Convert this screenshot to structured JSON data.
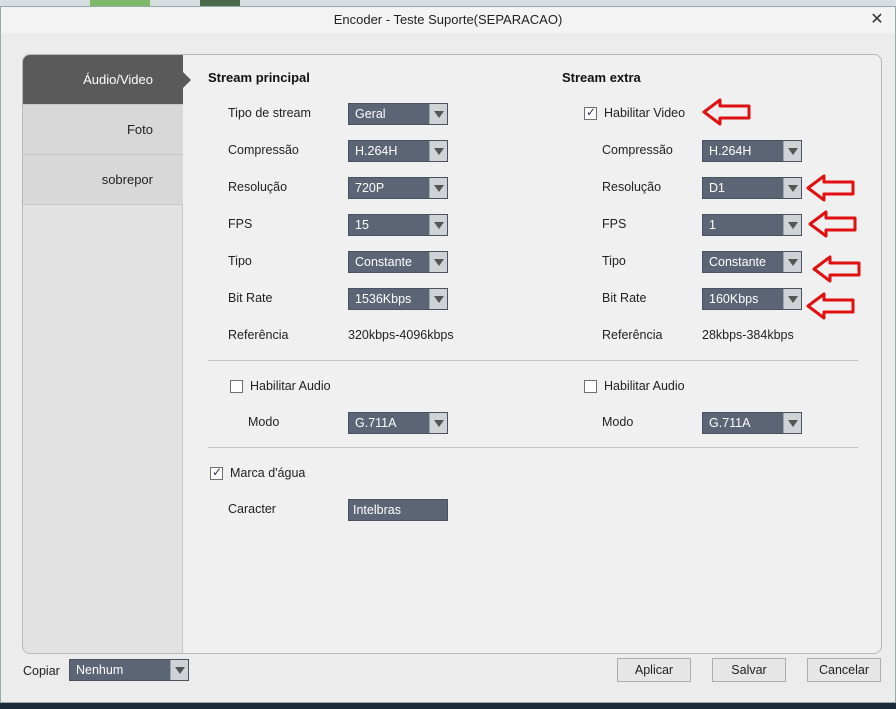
{
  "window": {
    "title": "Encoder  - Teste Suporte(SEPARACAO)",
    "close": "✕"
  },
  "sidebar": {
    "items": [
      {
        "label": "Áudio/Video",
        "active": true
      },
      {
        "label": "Foto",
        "active": false
      },
      {
        "label": "sobrepor",
        "active": false
      }
    ]
  },
  "main": {
    "title": "Stream principal",
    "rows": [
      {
        "label": "Tipo de stream",
        "value": "Geral"
      },
      {
        "label": "Compressão",
        "value": "H.264H"
      },
      {
        "label": "Resolução",
        "value": "720P"
      },
      {
        "label": "FPS",
        "value": "15"
      },
      {
        "label": "Tipo",
        "value": "Constante"
      },
      {
        "label": "Bit  Rate",
        "value": "1536Kbps"
      },
      {
        "label": "Referência",
        "value": "320kbps-4096kbps"
      }
    ],
    "audio": {
      "label": "Habilitar Audio",
      "checked": false,
      "mode_label": "Modo",
      "mode_value": "G.711A"
    }
  },
  "extra": {
    "title": "Stream extra",
    "enable_video": {
      "label": "Habilitar Video",
      "checked": true
    },
    "rows": [
      {
        "label": "Compressão",
        "value": "H.264H"
      },
      {
        "label": "Resolução",
        "value": "D1"
      },
      {
        "label": "FPS",
        "value": "1"
      },
      {
        "label": "Tipo",
        "value": "Constante"
      },
      {
        "label": "Bit  Rate",
        "value": "160Kbps"
      },
      {
        "label": "Referência",
        "value": "28kbps-384kbps"
      }
    ],
    "audio": {
      "label": "Habilitar Audio",
      "checked": false,
      "mode_label": "Modo",
      "mode_value": "G.711A"
    }
  },
  "watermark": {
    "label": "Marca d'água",
    "checked": true,
    "char_label": "Caracter",
    "char_value": "Intelbras"
  },
  "footer": {
    "copy_label": "Copiar",
    "copy_value": "Nenhum",
    "apply": "Aplicar",
    "save": "Salvar",
    "cancel": "Cancelar"
  },
  "colors": {
    "annotation_arrow": "#e01010",
    "select_bg": "#5b6575",
    "active_tab": "#5a5a5a"
  }
}
